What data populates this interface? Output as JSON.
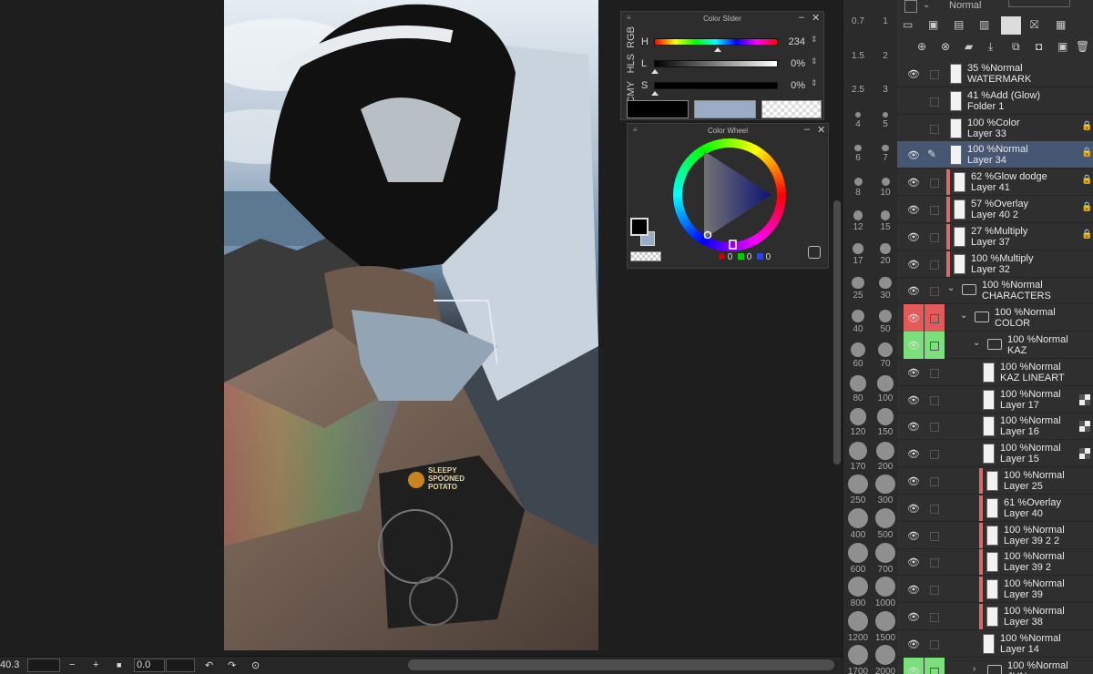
{
  "canvas": {
    "watermark_text": "SLEEPY SPOONED POTATO"
  },
  "color_slider": {
    "title": "Color Slider",
    "tabs": [
      "RGB",
      "HLS",
      "CMY"
    ],
    "rows": [
      {
        "label": "H",
        "value": "234"
      },
      {
        "label": "L",
        "value": "0%"
      },
      {
        "label": "S",
        "value": "0%"
      }
    ],
    "main_color": "#000000",
    "sub_color": "#9aacc6"
  },
  "color_wheel": {
    "title": "Color Wheel",
    "r": "0",
    "g": "0",
    "b": "0"
  },
  "brush_sizes": [
    {
      "a": "0.7",
      "b": "1"
    },
    {
      "a": "1.5",
      "b": "2"
    },
    {
      "a": "2.5",
      "b": "3"
    },
    {
      "a": "4",
      "b": "5"
    },
    {
      "a": "6",
      "b": "7"
    },
    {
      "a": "8",
      "b": "10"
    },
    {
      "a": "12",
      "b": "15"
    },
    {
      "a": "17",
      "b": "20"
    },
    {
      "a": "25",
      "b": "30"
    },
    {
      "a": "40",
      "b": "50"
    },
    {
      "a": "60",
      "b": "70"
    },
    {
      "a": "80",
      "b": "100"
    },
    {
      "a": "120",
      "b": "150"
    },
    {
      "a": "170",
      "b": "200"
    },
    {
      "a": "250",
      "b": "300"
    },
    {
      "a": "400",
      "b": "500"
    },
    {
      "a": "600",
      "b": "700"
    },
    {
      "a": "800",
      "b": "1000"
    },
    {
      "a": "1200",
      "b": "1500"
    },
    {
      "a": "1700",
      "b": "2000"
    }
  ],
  "layer_panel": {
    "blend_mode": "Normal",
    "layers": [
      {
        "t1": "35 %Normal",
        "t2": "WATERMARK",
        "eye": true
      },
      {
        "t1": "41 %Add (Glow)",
        "t2": "Folder 1",
        "eye": false
      },
      {
        "t1": "100 %Color",
        "t2": "Layer 33",
        "eye": false,
        "lock": true
      },
      {
        "t1": "100 %Normal",
        "t2": "Layer 34",
        "eye": true,
        "lock": true,
        "selected": true
      },
      {
        "t1": "62 %Glow dodge",
        "t2": "Layer 41",
        "eye": true,
        "lock": true,
        "clip": true
      },
      {
        "t1": "57 %Overlay",
        "t2": "Layer 40 2",
        "eye": true,
        "lock": true,
        "clip": true
      },
      {
        "t1": "27 %Multiply",
        "t2": "Layer 37",
        "eye": true,
        "lock": true,
        "clip": true
      },
      {
        "t1": "100 %Multiply",
        "t2": "Layer 32",
        "eye": true,
        "clip": true
      },
      {
        "t1": "100 %Normal",
        "t2": "CHARACTERS",
        "eye": true,
        "folder": 1
      },
      {
        "t1": "100 %Normal",
        "t2": "COLOR",
        "eye": true,
        "folder": 2
      },
      {
        "t1": "100 %Normal",
        "t2": "KAZ",
        "eye": true,
        "folder": 3
      },
      {
        "t1": "100 %Normal",
        "t2": "KAZ LINEART",
        "eye": true,
        "indent": 3
      },
      {
        "t1": "100 %Normal",
        "t2": "Layer 17",
        "eye": true,
        "indent": 3,
        "ref": true
      },
      {
        "t1": "100 %Normal",
        "t2": "Layer 16",
        "eye": true,
        "indent": 3,
        "ref": true
      },
      {
        "t1": "100 %Normal",
        "t2": "Layer 15",
        "eye": true,
        "indent": 3,
        "ref": true
      },
      {
        "t1": "100 %Normal",
        "t2": "Layer 25",
        "eye": true,
        "indent": 3,
        "clip": true
      },
      {
        "t1": "61 %Overlay",
        "t2": "Layer 40",
        "eye": true,
        "indent": 3,
        "clip": true
      },
      {
        "t1": "100 %Normal",
        "t2": "Layer 39 2 2",
        "eye": true,
        "indent": 3,
        "clip": true
      },
      {
        "t1": "100 %Normal",
        "t2": "Layer 39 2",
        "eye": true,
        "indent": 3,
        "clip": true
      },
      {
        "t1": "100 %Normal",
        "t2": "Layer 39",
        "eye": true,
        "indent": 3,
        "clip": true
      },
      {
        "t1": "100 %Normal",
        "t2": "Layer 38",
        "eye": true,
        "indent": 3,
        "clip": true
      },
      {
        "t1": "100 %Normal",
        "t2": "Layer 14",
        "eye": true,
        "indent": 3
      },
      {
        "t1": "100 %Normal",
        "t2": "JUN",
        "eye": true,
        "folder": 3,
        "collapsed": true
      }
    ]
  },
  "bottom_bar": {
    "zoom": "40.3",
    "minus": "−",
    "plus": "+",
    "stop": "■",
    "angle": "0.0"
  },
  "colors": {
    "highlight_red": "#e35a5a",
    "highlight_green": "#7be07b",
    "selection": "#475672",
    "clip_marker": "#d46c6c"
  }
}
